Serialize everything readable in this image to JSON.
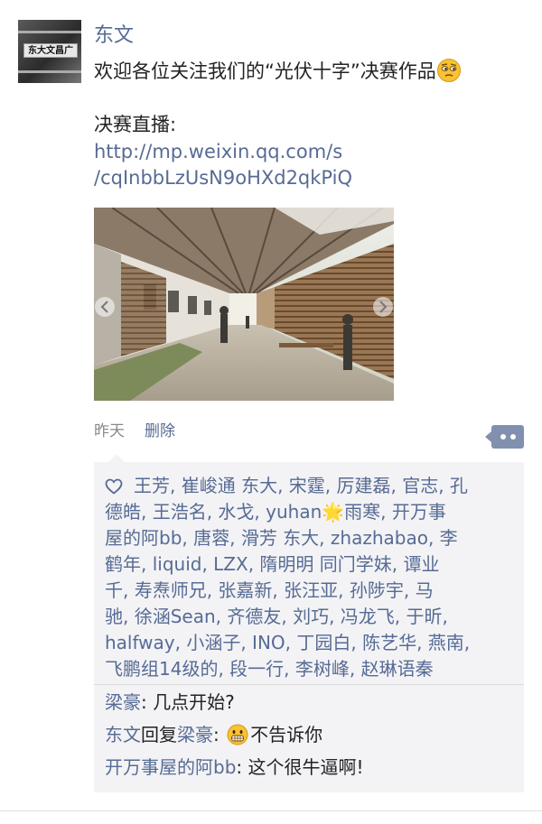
{
  "post": {
    "author": "东文",
    "avatar_sign": "东大文昌广",
    "text": "欢迎各位关注我们的“光伏十字”决赛作品",
    "live_label": "决赛直播:",
    "link_line1": "http://mp.weixin.qq.com/s",
    "link_line2": "/cqInbbLzUsN9oHXd2qkPiQ",
    "time": "昨天",
    "delete_label": "删除"
  },
  "likes": {
    "text": "王芳, 崔峻通 东大, 宋霆, 厉建磊, 官志, 孔\n德皓, 王浩名, 水戈, yuhan🌟雨寒, 开万事\n屋的阿bb, 唐蓉, 滑芳 东大, zhazhabao, 李\n鹤年, liquid, LZX, 隋明明 同门学妹, 谭业\n千, 寿焘师兄, 张嘉新, 张汪亚, 孙陟宇, 马\n驰, 徐涵Sean, 齐德友, 刘巧, 冯龙飞, 于昕,\nhalfway, 小涵子, INO, 丁园白, 陈艺华, 燕南,\n飞鹏组14级的, 段一行, 李树峰, 赵琳语秦"
  },
  "comments": [
    {
      "name": "梁豪",
      "text": ": 几点开始?"
    },
    {
      "name": "东文",
      "reply_word": "回复",
      "reply_to": "梁豪",
      "text_before": ":",
      "text": "不告诉你"
    },
    {
      "name": "开万事屋的阿bb",
      "text": ": 这个很牛逼啊!"
    }
  ],
  "colors": {
    "link": "#576b95",
    "comment_bg": "#f3f3f5",
    "more_btn": "#8190ae"
  }
}
